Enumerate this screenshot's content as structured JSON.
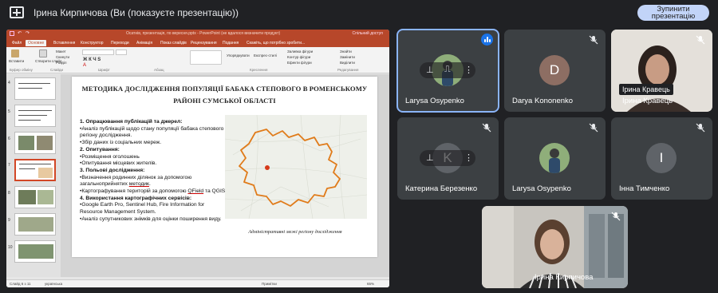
{
  "top_bar": {
    "title": "Ірина Кирпичова (Ви (показуєте презентацію))",
    "stop_button_line1": "Зупинити",
    "stop_button_line2": "презентацію"
  },
  "powerpoint": {
    "doc_title": "Осатнів, презентація, по вересня.pptx - PowerPoint (не вдалося визначити продукт)",
    "user": "Спільний доступ",
    "tabs": [
      "Файл",
      "Основне",
      "Вставлення",
      "Конструктор",
      "Переходи",
      "Анімація",
      "Показ слайдів",
      "Рецензування",
      "Подання",
      "Скажіть, що потрібно зробити..."
    ],
    "ribbon": {
      "paste": "Вставити",
      "new_slide": "Створити слайд",
      "layout": "Макет",
      "reset": "Скинути",
      "section": "Розділ",
      "arrange": "Упорядкувати",
      "quick_styles": "Експрес-стилі",
      "shape_fill": "Заливка фігури",
      "shape_outline": "Контур фігури",
      "shape_effects": "Ефекти фігури",
      "find": "Знайти",
      "replace": "Замінити",
      "select": "Виділити",
      "group_clipboard": "Буфер обміну",
      "group_slides": "Слайди",
      "group_font": "Шрифт",
      "group_paragraph": "Абзац",
      "group_drawing": "Креслення",
      "group_editing": "Редагування"
    },
    "thumb_numbers": [
      "4",
      "5",
      "6",
      "7",
      "8",
      "9",
      "10"
    ],
    "status": {
      "slide": "Слайд 6 з 11",
      "language": "українська",
      "notes": "Примітки",
      "zoom": "65%"
    }
  },
  "slide": {
    "title": "МЕТОДИКА ДОСЛІДЖЕННЯ ПОПУЛЯЦІЇ БАБАКА СТЕПОВОГО В РОМЕНСЬКОМУ РАЙОНІ СУМСЬКОЇ ОБЛАСТІ",
    "section1_heading": "1. Опрацювання публікацій та джерел:",
    "section1_item1": "•Аналіз публікацій щодо стану популяції бабака степового регіону дослідження.",
    "section1_item2": "•Збір даних із соціальних мереж.",
    "section2_heading": "2. Опитування:",
    "section2_item1": "•Розміщення оголошень",
    "section2_item2": "•Опитування місцевих жителів.",
    "section3_heading": "3. Польові дослідження:",
    "section3_item1_a": "•Визначення родинних ділянок за допомогою загальноприйнятих ",
    "section3_item1_b": "методик",
    "section3_item1_c": ".",
    "section3_item2_a": "•Картографування територій за допомогою ",
    "section3_item2_b": "QField",
    "section3_item2_c": " та QGIS.",
    "section4_heading": "4. Використання картографічних сервісів:",
    "section4_item1": "•Google Earth Pro, Sentinel Hub, Fire Information for Resource Management System.",
    "section4_item2": "•Аналіз супутникових знімків для оцінки поширення виду.",
    "map_caption": "Адміністративні межі регіону дослідження"
  },
  "participants": [
    {
      "name": "Larysa Osypenko",
      "state": "speaking",
      "photo": true
    },
    {
      "name": "Darya Kononenko",
      "initial": "D",
      "avatar_color": "#8d6e63"
    },
    {
      "name": "Ірина Кравець",
      "label_chip": "Ірина Кравець",
      "photo": true
    },
    {
      "name": "Катерина Березенко",
      "initial": "K",
      "avatar_color": "#5f6368"
    },
    {
      "name": "Larysa Osypenko",
      "photo": true
    },
    {
      "name": "Інна Тимченко",
      "initial": "I",
      "avatar_color": "#5f6368"
    },
    {
      "name": "Ірина Кирпичова",
      "photo": true
    }
  ],
  "colors": {
    "accent": "#8ab4f8",
    "stop_button": "#c2d4f8",
    "powerpoint_red": "#b7472a",
    "map_border": "#e07b1a"
  }
}
